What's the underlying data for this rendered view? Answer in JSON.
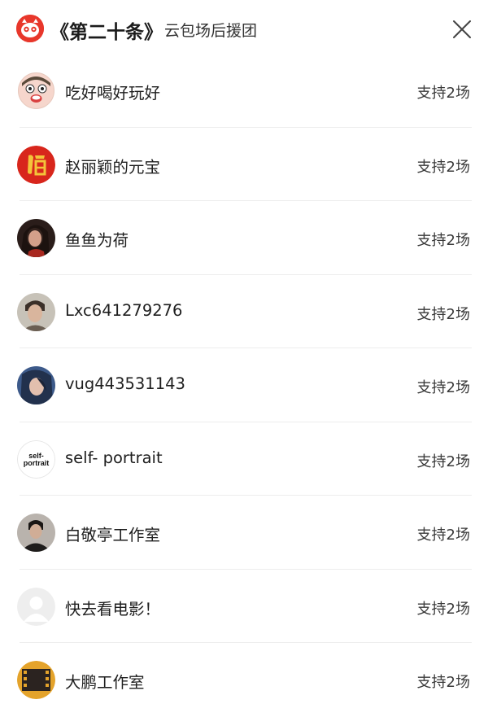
{
  "header": {
    "title": "《第二十条》",
    "subtitle": "云包场后援团",
    "logo_icon": "cat-logo-icon",
    "close_icon": "close-icon",
    "brand_color": "#e8372b"
  },
  "supporters": [
    {
      "name": "吃好喝好玩好",
      "support": "支持2场",
      "avatar": "cartoon-boy-avatar"
    },
    {
      "name": "赵丽颖的元宝",
      "support": "支持2场",
      "avatar": "fu-character-avatar"
    },
    {
      "name": "鱼鱼为荷",
      "support": "支持2场",
      "avatar": "woman-portrait-avatar"
    },
    {
      "name": "Lxc641279276",
      "support": "支持2场",
      "avatar": "man-portrait-avatar"
    },
    {
      "name": "vug443531143",
      "support": "支持2场",
      "avatar": "woman-blue-avatar"
    },
    {
      "name": "self- portrait",
      "support": "支持2场",
      "avatar": "self-portrait-logo-avatar",
      "avatar_text": "self-\nportrait"
    },
    {
      "name": "白敬亭工作室",
      "support": "支持2场",
      "avatar": "man-dark-avatar"
    },
    {
      "name": "快去看电影！",
      "support": "支持2场",
      "avatar": "default-user-avatar"
    },
    {
      "name": "大鹏工作室",
      "support": "支持2场",
      "avatar": "film-strip-avatar"
    }
  ]
}
